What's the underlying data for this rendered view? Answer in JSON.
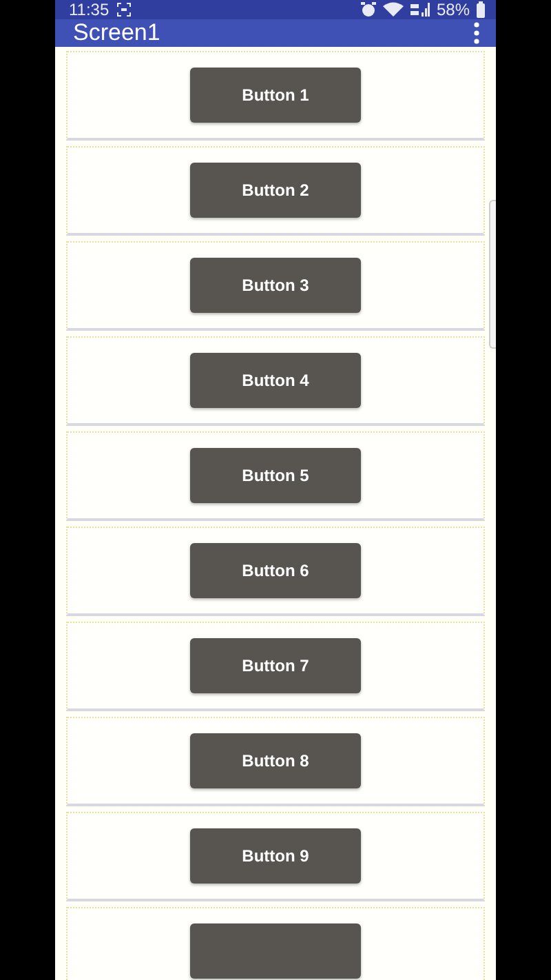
{
  "status_bar": {
    "time": "11:35",
    "battery": "58%"
  },
  "app_bar": {
    "title": "Screen1"
  },
  "cards": [
    {
      "kind": "button",
      "label": "Button 1"
    },
    {
      "kind": "button",
      "label": "Button 2"
    },
    {
      "kind": "button",
      "label": "Button 3"
    },
    {
      "kind": "button",
      "label": "Button 4"
    },
    {
      "kind": "button",
      "label": "Button 5"
    },
    {
      "kind": "button",
      "label": "Button 6"
    },
    {
      "kind": "button",
      "label": "Button 7"
    },
    {
      "kind": "button",
      "label": "Button 8"
    },
    {
      "kind": "button",
      "label": "Button 9"
    },
    {
      "kind": "cut"
    }
  ]
}
